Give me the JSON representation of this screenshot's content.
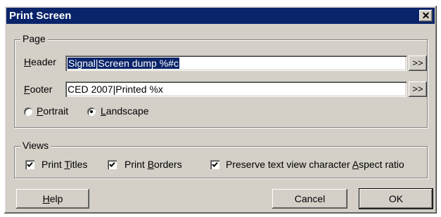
{
  "window": {
    "title": "Print Screen",
    "close_label": "✕"
  },
  "page_group": {
    "label": "Page",
    "header": {
      "label_ul": "H",
      "label_rest": "eader",
      "value": "Signal|Screen dump %#c",
      "browse_label": ">>"
    },
    "footer": {
      "label_ul": "F",
      "label_rest": "ooter",
      "value": "CED 2007|Printed %x",
      "browse_label": ">>"
    },
    "orientation": {
      "portrait": {
        "label_ul": "P",
        "label_rest": "ortrait",
        "selected": false
      },
      "landscape": {
        "label_ul": "L",
        "label_rest": "andscape",
        "selected": true
      }
    }
  },
  "views_group": {
    "label": "Views",
    "print_titles": {
      "label_pre": "Print ",
      "label_ul": "T",
      "label_rest": "itles",
      "checked": true
    },
    "print_borders": {
      "label_pre": "Print ",
      "label_ul": "B",
      "label_rest": "orders",
      "checked": true
    },
    "preserve_aspect": {
      "label_pre": "Preserve text view character ",
      "label_ul": "A",
      "label_rest": "spect ratio",
      "checked": true
    }
  },
  "buttons": {
    "help": {
      "label_ul": "H",
      "label_rest": "elp"
    },
    "cancel": "Cancel",
    "ok": "OK"
  }
}
